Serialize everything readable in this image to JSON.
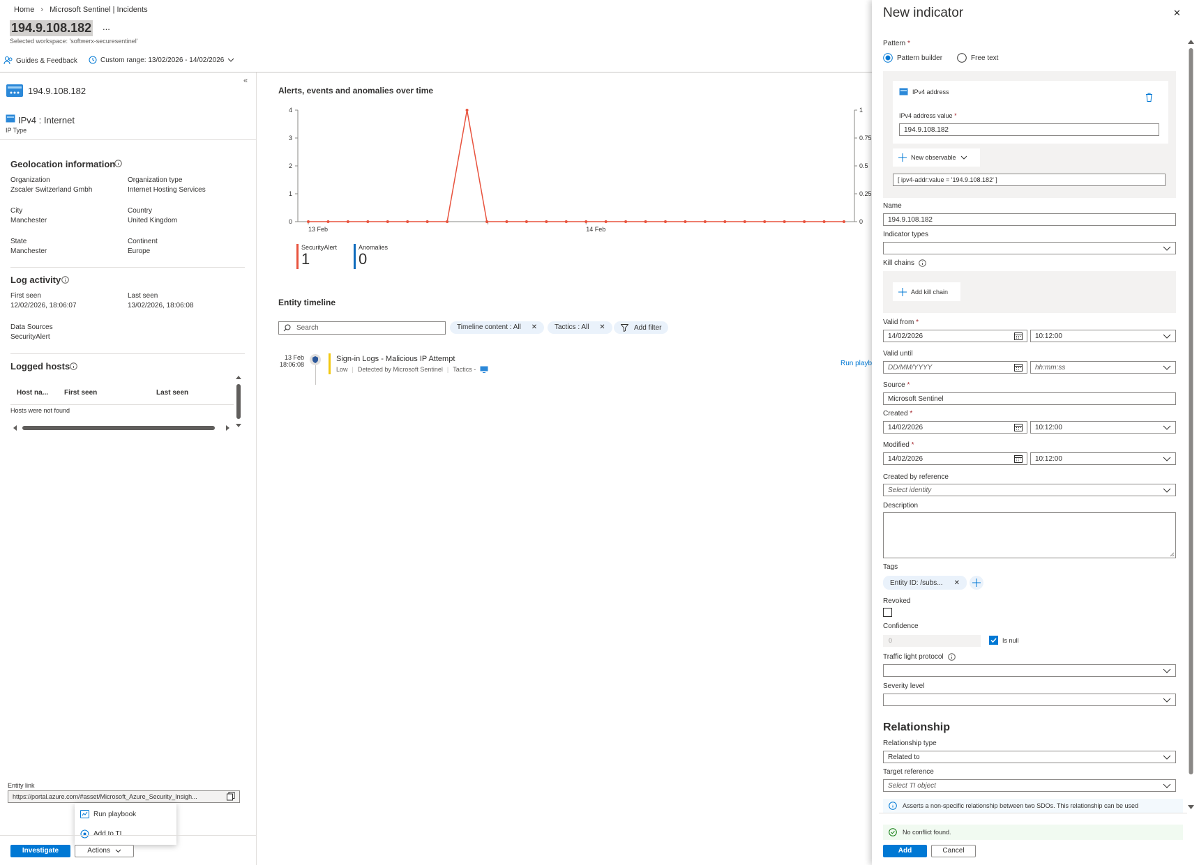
{
  "breadcrumb": {
    "home": "Home",
    "sep": "›",
    "current": "Microsoft Sentinel | Incidents"
  },
  "page": {
    "title": "194.9.108.182",
    "more": "...",
    "workspace": "Selected workspace: 'softwerx-securesentinel'"
  },
  "toolbar": {
    "guides": "Guides & Feedback",
    "range": "Custom range: 13/02/2026 - 14/02/2026"
  },
  "left": {
    "collapse": "«",
    "entity_name": "194.9.108.182",
    "ip_kind": "IPv4 : Internet",
    "ip_type_label": "IP Type",
    "geo": {
      "title": "Geolocation information",
      "org_label": "Organization",
      "org": "Zscaler Switzerland Gmbh",
      "orgtype_label": "Organization type",
      "orgtype": "Internet Hosting Services",
      "city_label": "City",
      "city": "Manchester",
      "country_label": "Country",
      "country": "United Kingdom",
      "state_label": "State",
      "state": "Manchester",
      "continent_label": "Continent",
      "continent": "Europe"
    },
    "log": {
      "title": "Log activity",
      "first_label": "First seen",
      "first": "12/02/2026, 18:06:07",
      "last_label": "Last seen",
      "last": "13/02/2026, 18:06:08",
      "sources_label": "Data Sources",
      "sources": "SecurityAlert"
    },
    "hosts": {
      "title": "Logged hosts",
      "columns": [
        "Host na...",
        "First seen",
        "Last seen"
      ],
      "empty": "Hosts were not found"
    },
    "entity_link_label": "Entity link",
    "entity_link": "https://portal.azure.com/#asset/Microsoft_Azure_Security_Insigh...",
    "menu": {
      "run_playbook": "Run playbook",
      "add_ti": "Add to TI"
    },
    "investigate": "Investigate",
    "actions": "Actions"
  },
  "center": {
    "chart_title": "Alerts, events and anomalies over time",
    "legend": [
      {
        "name": "SecurityAlert",
        "value": "1",
        "color": "#e8533e"
      },
      {
        "name": "Anomalies",
        "value": "0",
        "color": "#0f6cbd"
      }
    ],
    "timeline": {
      "title": "Entity timeline",
      "search_placeholder": "Search",
      "filters": [
        "Timeline content : All",
        "Tactics : All"
      ],
      "add_filter": "Add filter",
      "item": {
        "date": "13 Feb",
        "time": "18:06:08",
        "title": "Sign-in Logs - Malicious IP Attempt",
        "severity": "Low",
        "source": "Detected by Microsoft Sentinel",
        "tactics": "Tactics -"
      },
      "run_playbook": "Run playb"
    }
  },
  "chart_data": {
    "type": "line",
    "title": "Alerts, events and anomalies over time",
    "x_tick_labels": [
      "13 Feb",
      "14 Feb"
    ],
    "y_left_ticks": [
      "0",
      "1",
      "2",
      "3",
      "4"
    ],
    "y_right_ticks": [
      "0",
      "0.25",
      "0.5",
      "0.75",
      "1"
    ],
    "ylim": [
      0,
      4
    ],
    "y2lim": [
      0,
      1
    ],
    "series": [
      {
        "name": "SecurityAlert",
        "color": "#e8533e",
        "values": [
          0,
          0,
          0,
          0,
          0,
          0,
          0,
          0,
          1,
          0,
          0,
          0,
          0,
          0,
          0,
          0,
          0,
          0,
          0,
          0,
          0,
          0,
          0,
          0,
          0,
          0,
          0,
          0
        ]
      }
    ]
  },
  "panel": {
    "title": "New indicator",
    "close": "✕",
    "pattern_label": "Pattern",
    "req": "*",
    "radio_builder": "Pattern builder",
    "radio_free": "Free text",
    "observable_type": "IPv4 address",
    "ipv4_value_label": "IPv4 address value",
    "ipv4_value": "194.9.108.182",
    "new_observable": "New observable",
    "pattern_preview": "[ ipv4-addr:value = '194.9.108.182' ]",
    "name_label": "Name",
    "name": "194.9.108.182",
    "indicator_types_label": "Indicator types",
    "kill_chains_label": "Kill chains",
    "add_kill_chain": "Add kill chain",
    "valid_from_label": "Valid from",
    "valid_from_date": "14/02/2026",
    "valid_from_time": "10:12:00",
    "valid_until_label": "Valid until",
    "date_ph": "DD/MM/YYYY",
    "time_ph": "hh:mm:ss",
    "source_label": "Source",
    "source": "Microsoft Sentinel",
    "created_label": "Created",
    "created_date": "14/02/2026",
    "created_time": "10:12:00",
    "modified_label": "Modified",
    "modified_date": "14/02/2026",
    "modified_time": "10:12:00",
    "created_by_label": "Created by reference",
    "created_by_ph": "Select identity",
    "description_label": "Description",
    "tags_label": "Tags",
    "tag": "Entity ID: /subs...",
    "revoked_label": "Revoked",
    "confidence_label": "Confidence",
    "confidence_value": "0",
    "is_null": "Is null",
    "tlp_label": "Traffic light protocol",
    "severity_label": "Severity level",
    "relationship_title": "Relationship",
    "rel_type_label": "Relationship type",
    "rel_type": "Related to",
    "target_label": "Target reference",
    "target_ph": "Select TI object",
    "info": "Asserts a non-specific relationship between two SDOs. This relationship can be used",
    "status": "No conflict found.",
    "add": "Add",
    "cancel": "Cancel"
  }
}
